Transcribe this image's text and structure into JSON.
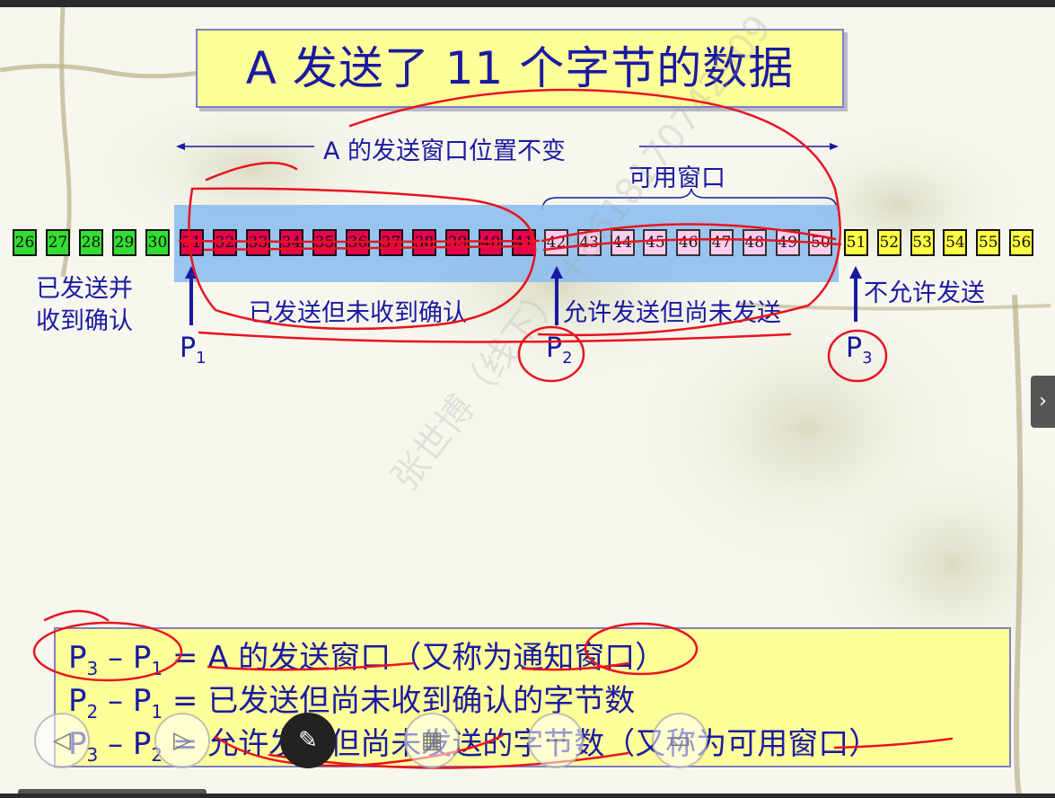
{
  "title": "A 发送了 11 个字节的数据",
  "labels": {
    "window_unchanged": "A 的发送窗口位置不变",
    "usable_window": "可用窗口",
    "sent_and_acked": [
      "已发送并",
      "收到确认"
    ],
    "sent_not_acked": "已发送但未收到确认",
    "allowed_not_sent": "允许发送但尚未发送",
    "not_allowed": "不允许发送",
    "p1": "P",
    "p1_sub": "1",
    "p2": "P",
    "p2_sub": "2",
    "p3": "P",
    "p3_sub": "3"
  },
  "bytes": {
    "green": [
      "26",
      "27",
      "28",
      "29",
      "30"
    ],
    "red": [
      "31",
      "32",
      "33",
      "34",
      "35",
      "36",
      "37",
      "38",
      "39",
      "40",
      "41"
    ],
    "pink": [
      "42",
      "43",
      "44",
      "45",
      "46",
      "47",
      "48",
      "49",
      "50"
    ],
    "yellow": [
      "51",
      "52",
      "53",
      "54",
      "55",
      "56"
    ]
  },
  "formulas": [
    {
      "a": "P",
      "a_sub": "3",
      "b": "P",
      "b_sub": "1",
      "text": " = A 的发送窗口（又称为通知窗口）"
    },
    {
      "a": "P",
      "a_sub": "2",
      "b": "P",
      "b_sub": "1",
      "text": " = 已发送但尚未收到确认的字节数"
    },
    {
      "a": "P",
      "a_sub": "3",
      "b": "P",
      "b_sub": "2",
      "text": " = 允许发送但尚未发送的字节数（又称为可用窗口）"
    }
  ],
  "watermark": "张世博（线下） +8618170742909",
  "colors": {
    "green": "#33dd33",
    "red": "#e8004f",
    "pink": "#ffccee",
    "yellow": "#ffff44",
    "text_blue": "#1a1aa0",
    "window_band": "#88bbf0",
    "annotation_red": "#e8141e"
  },
  "controls": [
    "prev-icon",
    "next-icon",
    "pen-icon",
    "grid-icon",
    "more-icon",
    "screen-icon",
    "chevron-right-icon"
  ]
}
